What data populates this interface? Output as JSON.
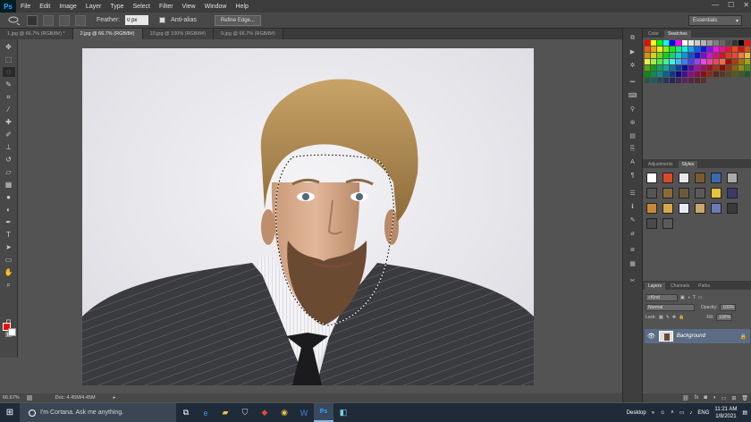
{
  "app": {
    "logo": "Ps"
  },
  "menu": [
    "File",
    "Edit",
    "Image",
    "Layer",
    "Type",
    "Select",
    "Filter",
    "View",
    "Window",
    "Help"
  ],
  "window_controls": {
    "minimize": "—",
    "maximize": "☐",
    "close": "✕"
  },
  "options": {
    "feather_label": "Feather:",
    "feather_value": "0 px",
    "anti_alias_label": "Anti-alias",
    "refine_label": "Refine Edge...",
    "workspace": "Essentials"
  },
  "tabs": [
    {
      "label": "1.jpg @ 66.7% (RGB/8#) *",
      "active": false
    },
    {
      "label": "2.jpg @ 66.7% (RGB/8#)",
      "active": true
    },
    {
      "label": "10.jpg @ 100% (RGB/8#)",
      "active": false
    },
    {
      "label": "9.jpg @ 66.7% (RGB/8#)",
      "active": false
    }
  ],
  "status": {
    "zoom": "66.67%",
    "doc": "Doc: 4.45M/4.45M"
  },
  "colors": {
    "foreground": "#ff0000",
    "background": "#ffffff"
  },
  "panels": {
    "top_tabs": [
      "Color",
      "Swatches"
    ],
    "mid_tabs": [
      "Adjustments",
      "Styles"
    ],
    "layer_tabs": [
      "Layers",
      "Channels",
      "Paths"
    ],
    "kind_label": "Kind",
    "blend_mode": "Normal",
    "opacity_label": "Opacity:",
    "opacity_value": "100%",
    "lock_label": "Lock:",
    "fill_label": "Fill:",
    "fill_value": "100%",
    "layer_name": "Background"
  },
  "taskbar": {
    "search_placeholder": "I'm Cortana. Ask me anything.",
    "desktop_label": "Desktop",
    "lang": "ENG",
    "time": "11:21 AM",
    "date": "1/8/2021"
  }
}
